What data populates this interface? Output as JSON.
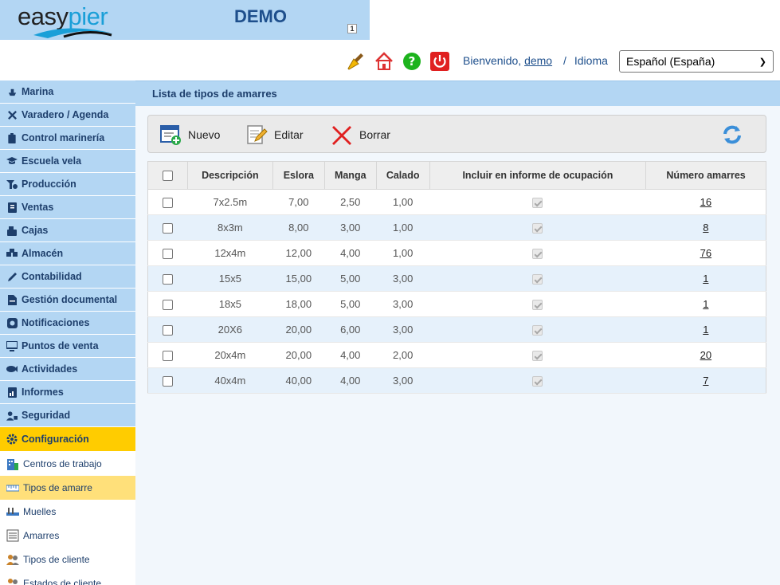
{
  "header": {
    "logo_easy": "easy",
    "logo_pier": "pier",
    "title": "DEMO",
    "badge": "1",
    "welcome_prefix": "Bienvenido,",
    "username": "demo",
    "separator": "/",
    "language_label": "Idioma",
    "language_value": "Español (España)"
  },
  "sidebar": {
    "items": [
      {
        "label": "Marina",
        "icon": "ship-icon"
      },
      {
        "label": "Varadero / Agenda",
        "icon": "tools-icon"
      },
      {
        "label": "Control marinería",
        "icon": "clipboard-icon"
      },
      {
        "label": "Escuela vela",
        "icon": "graduation-cap-icon"
      },
      {
        "label": "Producción",
        "icon": "production-icon"
      },
      {
        "label": "Ventas",
        "icon": "invoice-icon"
      },
      {
        "label": "Cajas",
        "icon": "cash-register-icon"
      },
      {
        "label": "Almacén",
        "icon": "warehouse-icon"
      },
      {
        "label": "Contabilidad",
        "icon": "pencil-icon"
      },
      {
        "label": "Gestión documental",
        "icon": "document-icon"
      },
      {
        "label": "Notificaciones",
        "icon": "notification-icon"
      },
      {
        "label": "Puntos de venta",
        "icon": "monitor-icon"
      },
      {
        "label": "Actividades",
        "icon": "fish-icon"
      },
      {
        "label": "Informes",
        "icon": "report-icon"
      },
      {
        "label": "Seguridad",
        "icon": "user-lock-icon"
      }
    ],
    "active_item": {
      "label": "Configuración",
      "icon": "gear-icon"
    },
    "sub_items": [
      {
        "label": "Centros de trabajo",
        "icon": "building-icon"
      },
      {
        "label": "Tipos de amarre",
        "icon": "ruler-icon"
      },
      {
        "label": "Muelles",
        "icon": "pier-icon"
      },
      {
        "label": "Amarres",
        "icon": "list-icon"
      },
      {
        "label": "Tipos de cliente",
        "icon": "users-icon"
      },
      {
        "label": "Estados de cliente",
        "icon": "users-icon"
      }
    ]
  },
  "main": {
    "title": "Lista de tipos de amarres",
    "toolbar": {
      "new_label": "Nuevo",
      "edit_label": "Editar",
      "delete_label": "Borrar"
    },
    "table": {
      "columns": [
        "Descripción",
        "Eslora",
        "Manga",
        "Calado",
        "Incluir en informe de ocupación",
        "Número amarres"
      ],
      "rows": [
        {
          "desc": "7x2.5m",
          "eslora": "7,00",
          "manga": "2,50",
          "calado": "1,00",
          "incluir": true,
          "num": "16"
        },
        {
          "desc": "8x3m",
          "eslora": "8,00",
          "manga": "3,00",
          "calado": "1,00",
          "incluir": true,
          "num": "8"
        },
        {
          "desc": "12x4m",
          "eslora": "12,00",
          "manga": "4,00",
          "calado": "1,00",
          "incluir": true,
          "num": "76"
        },
        {
          "desc": "15x5",
          "eslora": "15,00",
          "manga": "5,00",
          "calado": "3,00",
          "incluir": true,
          "num": "1"
        },
        {
          "desc": "18x5",
          "eslora": "18,00",
          "manga": "5,00",
          "calado": "3,00",
          "incluir": true,
          "num": "1"
        },
        {
          "desc": "20X6",
          "eslora": "20,00",
          "manga": "6,00",
          "calado": "3,00",
          "incluir": true,
          "num": "1"
        },
        {
          "desc": "20x4m",
          "eslora": "20,00",
          "manga": "4,00",
          "calado": "2,00",
          "incluir": true,
          "num": "20"
        },
        {
          "desc": "40x4m",
          "eslora": "40,00",
          "manga": "4,00",
          "calado": "3,00",
          "incluir": true,
          "num": "7"
        }
      ]
    }
  },
  "colors": {
    "header_bg": "#b3d6f3",
    "title_blue": "#1e4f8c",
    "active_menu": "#ffcc00",
    "active_sub": "#ffe07a",
    "row_alt": "#e6f1fb"
  }
}
